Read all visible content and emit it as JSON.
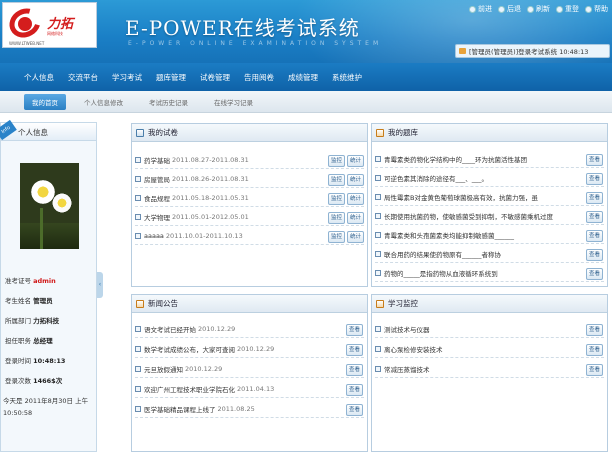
{
  "header": {
    "title": "E-POWER在线考试系统",
    "subtitle": "E-POWER ONLINE EXAMINATION SYSTEM",
    "logo_text": "力拓",
    "logo_sub": "网络科技",
    "logo_url": "WWW.LTWEB.NET"
  },
  "topmenu": [
    "前进",
    "后退",
    "刷新",
    "重登",
    "帮助"
  ],
  "userbar": "[管理员(管理员)]登录考试系统 10:48:13",
  "nav": [
    "个人信息",
    "交流平台",
    "学习考试",
    "题库管理",
    "试卷管理",
    "告用阅卷",
    "成绩管理",
    "系统维护"
  ],
  "subnav": [
    "我的首页",
    "个人信息修改",
    "考试历史记录",
    "在线学习记录"
  ],
  "left": {
    "title": "个人信息",
    "badge": "Info",
    "fields": [
      {
        "label": "准考证号",
        "value": "admin"
      },
      {
        "label": "考生姓名",
        "value": "管理员"
      },
      {
        "label": "所属部门",
        "value": "力拓科技"
      },
      {
        "label": "担任职务",
        "value": "总经理"
      },
      {
        "label": "登录时间",
        "value": "10:48:13"
      },
      {
        "label": "登录次数",
        "value": "1466$次"
      }
    ],
    "today": "今天是 2011年8月30日 上午",
    "time": "10:50:58"
  },
  "panels": {
    "exams": {
      "title": "我的试卷",
      "btn1": "监控",
      "btn2": "统计",
      "rows": [
        {
          "name": "药学基础",
          "date": "2011.08.27-2011.08.31"
        },
        {
          "name": "房屋管局",
          "date": "2011.08.26-2011.08.31"
        },
        {
          "name": "食品规程",
          "date": "2011.05.18-2011.05.31"
        },
        {
          "name": "大学物理",
          "date": "2011.05.01-2012.05.01"
        },
        {
          "name": "aaaaa",
          "date": "2011.10.01-2011.10.13"
        }
      ]
    },
    "bank": {
      "title": "我的题库",
      "btn": "查看",
      "rows": [
        "青霉素类药物化学结构中的____环为抗菌活性基团",
        "可逆色素其消除的途径有___、___。",
        "局性霉素B对金黄色葡萄球菌极高有效，抗菌力强，虽",
        "长期使用抗菌药物，使敏感菌受到抑制，不敏感菌乘机过度",
        "青霉素类和头孢菌素类均能抑制敏感菌______",
        "联合用药的结果使药物原有______者称协",
        "药物的_____是指药物从血液循环系统到"
      ]
    },
    "news": {
      "title": "新闻公告",
      "btn": "查看",
      "rows": [
        {
          "name": "语文考试已经开始",
          "date": "2010.12.29"
        },
        {
          "name": "数学考试成绩公布，大家可查阅",
          "date": "2010.12.29"
        },
        {
          "name": "元旦放假通知",
          "date": "2010.12.29"
        },
        {
          "name": "欢迎广州工程技术职业学院石化",
          "date": "2011.04.13"
        },
        {
          "name": "医学基础精品课程上线了",
          "date": "2011.08.25"
        }
      ]
    },
    "study": {
      "title": "学习监控",
      "btn": "查看",
      "rows": [
        "测试技术与仪器",
        "离心泵检修安装技术",
        "常减压蒸馏技术"
      ]
    }
  }
}
